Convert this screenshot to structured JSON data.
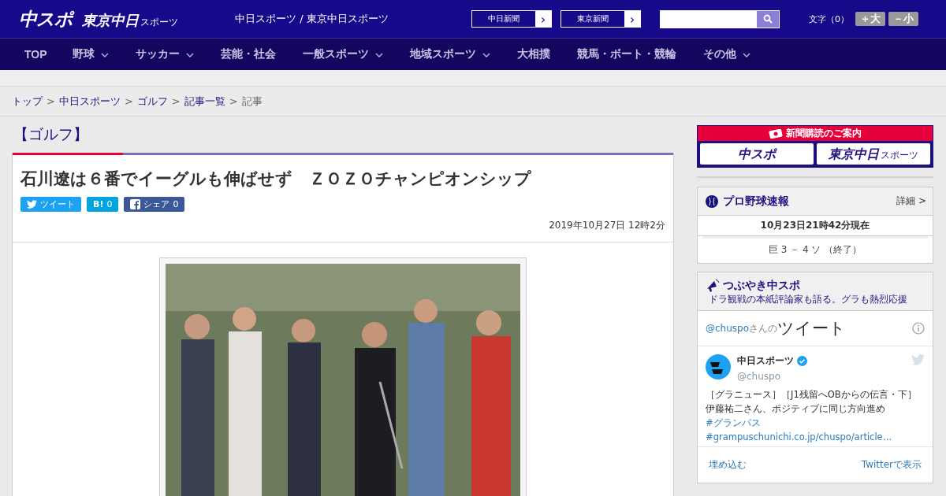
{
  "header": {
    "logo_main": "中スポ",
    "logo_tokyo": "東京中日",
    "logo_tokyo_sub": "スポーツ",
    "site_name": "中日スポーツ / 東京中日スポーツ",
    "paper_links": [
      {
        "label": "中日新聞",
        "arrow": "›"
      },
      {
        "label": "東京新聞",
        "arrow": "›"
      }
    ],
    "font_size_label": "文字（0）",
    "font_buttons": [
      "＋大",
      "－小"
    ]
  },
  "nav": [
    {
      "label": "TOP",
      "dropdown": false
    },
    {
      "label": "野球",
      "dropdown": true
    },
    {
      "label": "サッカー",
      "dropdown": true
    },
    {
      "label": "芸能・社会",
      "dropdown": false
    },
    {
      "label": "一般スポーツ",
      "dropdown": true
    },
    {
      "label": "地域スポーツ",
      "dropdown": true
    },
    {
      "label": "大相撲",
      "dropdown": false
    },
    {
      "label": "競馬・ボート・競輪",
      "dropdown": false
    },
    {
      "label": "その他",
      "dropdown": true
    }
  ],
  "breadcrumb": {
    "separator": ">",
    "items": [
      {
        "label": "トップ",
        "link": true
      },
      {
        "label": "中日スポーツ",
        "link": true
      },
      {
        "label": "ゴルフ",
        "link": true
      },
      {
        "label": "記事一覧",
        "link": true
      },
      {
        "label": "記事",
        "link": false
      }
    ]
  },
  "article": {
    "category": "【ゴルフ】",
    "title": "石川遼は６番でイーグルも伸ばせず　ＺＯＺＯチャンピオンシップ",
    "share": [
      {
        "kind": "twitter",
        "label": "ツイート"
      },
      {
        "kind": "hatena",
        "label": "B!",
        "count": "0"
      },
      {
        "kind": "facebook",
        "label": "シェア",
        "count": "0"
      }
    ],
    "date": "2019年10月27日 12時2分"
  },
  "sidebar": {
    "subscribe": {
      "title": "新聞購読のご案内",
      "logo_main": "中スポ",
      "logo_tokyo": "東京中日",
      "logo_tokyo_sub": "スポーツ"
    },
    "baseball": {
      "title": "プロ野球速報",
      "more": "詳細 >",
      "updated": "10月23日21時42分現在",
      "score": "巨 3 － 4 ソ （終了）"
    },
    "tweets": {
      "title": "つぶやき中スポ",
      "subtitle": "ドラ観戦の本紙評論家も語る。グラも熱烈応援",
      "handle_link": "@chuspo",
      "handle_suffix": "さんの",
      "heading": "ツイート",
      "account": "中日スポーツ",
      "account_handle": "@chuspo",
      "text": "［グラニュース］［J1残留へOBからの伝言・下］伊藤祐二さん、ポジティブに同じ方向進め",
      "tags": [
        "#グランパス",
        "#grampuschunichi.co.jp/chuspo/article…"
      ],
      "embed": "埋め込む",
      "view": "Twitterで表示"
    }
  }
}
